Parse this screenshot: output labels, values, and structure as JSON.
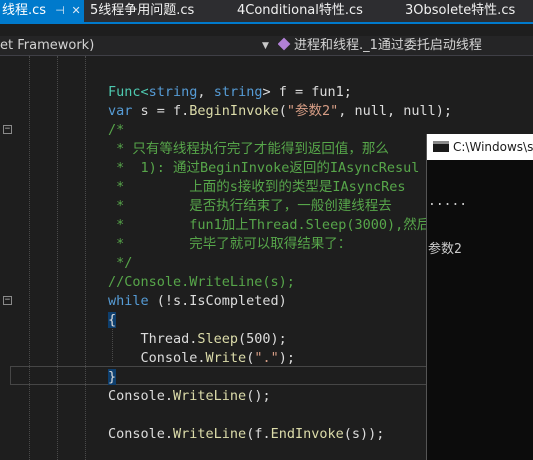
{
  "tabs": [
    {
      "label": "线程.cs",
      "pin": "⊣",
      "close": "✕",
      "active": true
    },
    {
      "label": "5线程争用问题.cs"
    },
    {
      "label": "4Conditional特性.cs"
    },
    {
      "label": "3Obsolete特性.cs"
    }
  ],
  "nav": {
    "left": "et Framework)",
    "right": "进程和线程._1通过委托启动线程"
  },
  "code": [
    [
      {
        "t": "Func<",
        "c": "ty"
      },
      {
        "t": "string",
        "c": "kw"
      },
      {
        "t": ", ",
        "c": "plain"
      },
      {
        "t": "string",
        "c": "kw"
      },
      {
        "t": "> f = fun1;",
        "c": "plain"
      }
    ],
    [
      {
        "t": "var",
        "c": "kw"
      },
      {
        "t": " s = f.",
        "c": "plain"
      },
      {
        "t": "BeginInvoke",
        "c": "fn"
      },
      {
        "t": "(",
        "c": "plain"
      },
      {
        "t": "\"参数2\"",
        "c": "str"
      },
      {
        "t": ", null, null);",
        "c": "plain"
      }
    ],
    [
      {
        "t": "/*",
        "c": "cm"
      }
    ],
    [
      {
        "t": " * 只有等线程执行完了才能得到返回值，那么",
        "c": "cm"
      }
    ],
    [
      {
        "t": " *  1): 通过BeginInvoke返回的IAsyncResul",
        "c": "cm"
      }
    ],
    [
      {
        "t": " *        上面的s接收到的类型是IAsyncRes",
        "c": "cm"
      }
    ],
    [
      {
        "t": " *        是否执行结束了，一般创建线程去",
        "c": "cm"
      }
    ],
    [
      {
        "t": " *        fun1加上Thread.Sleep(3000),然后",
        "c": "cm"
      }
    ],
    [
      {
        "t": " *        完毕了就可以取得结果了：",
        "c": "cm"
      }
    ],
    [
      {
        "t": " */",
        "c": "cm"
      }
    ],
    [
      {
        "t": "//Console.WriteLine(s);",
        "c": "cm"
      }
    ],
    [
      {
        "t": "while",
        "c": "kw"
      },
      {
        "t": " (!s.IsCompleted)",
        "c": "plain"
      }
    ],
    [
      {
        "t": "{",
        "c": "plain",
        "b": true
      }
    ],
    [
      {
        "t": "    Thread.",
        "c": "plain"
      },
      {
        "t": "Sleep",
        "c": "fn"
      },
      {
        "t": "(500);",
        "c": "plain"
      }
    ],
    [
      {
        "t": "    Console.",
        "c": "plain"
      },
      {
        "t": "Write",
        "c": "fn"
      },
      {
        "t": "(",
        "c": "plain"
      },
      {
        "t": "\".\"",
        "c": "str"
      },
      {
        "t": ");",
        "c": "plain"
      }
    ],
    [
      {
        "t": "}",
        "c": "plain",
        "b": true
      }
    ],
    [
      {
        "t": "Console.",
        "c": "plain"
      },
      {
        "t": "WriteLine",
        "c": "fn"
      },
      {
        "t": "();",
        "c": "plain"
      }
    ],
    [
      {
        "t": "",
        "c": "plain"
      }
    ],
    [
      {
        "t": "Console.",
        "c": "plain"
      },
      {
        "t": "WriteLine",
        "c": "fn"
      },
      {
        "t": "(f.",
        "c": "plain"
      },
      {
        "t": "EndInvoke",
        "c": "fn"
      },
      {
        "t": "(s));",
        "c": "plain"
      }
    ]
  ],
  "fold_glyph": "−",
  "console": {
    "title": "C:\\Windows\\s",
    "lines": [
      ".....",
      "参数2"
    ]
  }
}
